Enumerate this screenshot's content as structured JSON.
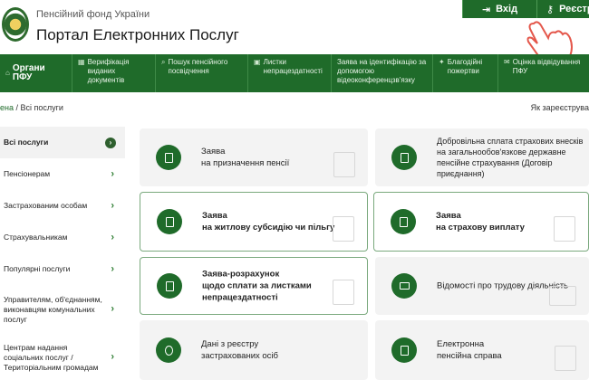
{
  "header": {
    "org_name": "Пенсійний фонд України",
    "portal_title": "Портал Електронних Послуг",
    "login_label": "Вхід",
    "register_label": "Реєстра"
  },
  "nav": {
    "items": [
      {
        "label": "Органи ПФУ",
        "icon": "home-icon"
      },
      {
        "label": "Верифікація виданих документів",
        "icon": "grid-icon"
      },
      {
        "label": "Пошук пенсійного посвідчення",
        "icon": "search-icon"
      },
      {
        "label": "Листки непрацездатності",
        "icon": "camera-icon"
      },
      {
        "label": "Заява на ідентифікацію за допомогою відеоконференцзв'язку",
        "icon": ""
      },
      {
        "label": "Благодійні пожертви",
        "icon": "gift-icon"
      },
      {
        "label": "Оцінка відвідування ПФУ",
        "icon": "chat-icon"
      }
    ]
  },
  "breadcrumb": {
    "home": "ена",
    "separator": " / ",
    "current": "Всі послуги"
  },
  "registered_text": "Як зареєструва",
  "sidebar": {
    "items": [
      {
        "label": "Всі послуги"
      },
      {
        "label": "Пенсіонерам"
      },
      {
        "label": "Застрахованим особам"
      },
      {
        "label": "Страхувальникам"
      },
      {
        "label": "Популярні послуги"
      },
      {
        "label": "Управителям, об'єднанням, виконавцям комунальних послуг"
      },
      {
        "label": "Центрам надання соціальних послуг / Територіальним громадам"
      }
    ]
  },
  "cards": [
    {
      "line1": "Заява",
      "line2": "на призначення пенсії",
      "line3": ""
    },
    {
      "line1": "Добровільна сплата страхових внесків",
      "line2": "на загальнообов'язкове державне",
      "line3": "пенсійне страхування (Договір",
      "line4": "приєднання)"
    },
    {
      "line1": "Заява",
      "line2": "на житлову субсидію чи пільгу",
      "line3": ""
    },
    {
      "line1": "Заява",
      "line2": "на страхову виплату",
      "line3": ""
    },
    {
      "line1": "Заява-розрахунок",
      "line2": "щодо сплати за листками",
      "line3": "непрацездатності"
    },
    {
      "line1": "Відомості про трудову діяльність",
      "line2": "",
      "line3": ""
    },
    {
      "line1": "Дані з реєстру",
      "line2": "застрахованих осіб",
      "line3": ""
    },
    {
      "line1": "Електронна",
      "line2": "пенсійна справа",
      "line3": ""
    }
  ],
  "colors": {
    "brand_green": "#1f6b2a"
  }
}
